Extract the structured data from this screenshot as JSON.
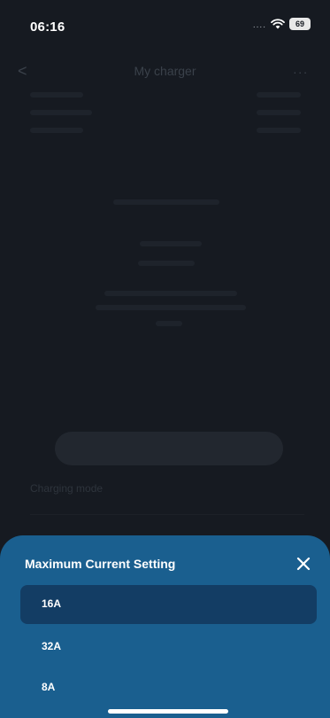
{
  "status_bar": {
    "time": "06:16",
    "signal": "....",
    "battery": "69"
  },
  "background": {
    "back_glyph": "<",
    "title": "My charger",
    "more_glyph": "...",
    "charging_label": "Charging mode"
  },
  "sheet": {
    "title": "Maximum Current Setting",
    "options": [
      {
        "label": "16A",
        "selected": true
      },
      {
        "label": "32A",
        "selected": false
      },
      {
        "label": "8A",
        "selected": false
      }
    ]
  },
  "colors": {
    "sheet_bg": "#1a5f8f",
    "selected_bg": "#133d64",
    "app_bg": "#161a21"
  }
}
